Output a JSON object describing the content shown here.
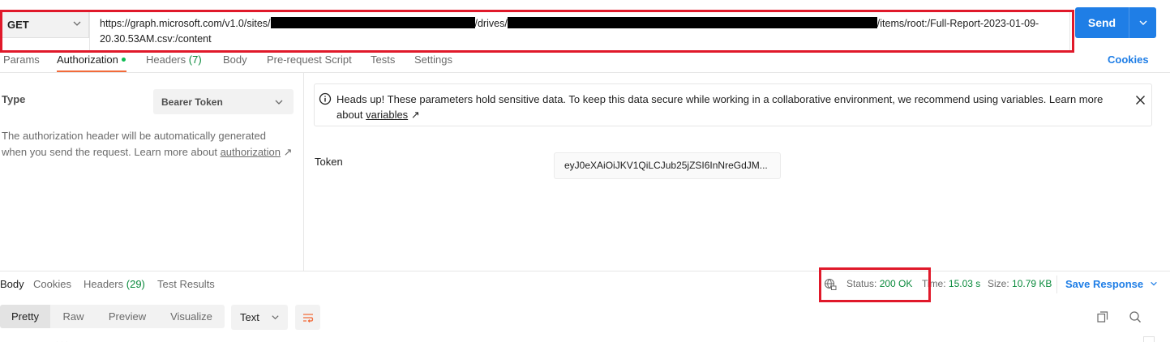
{
  "request": {
    "method": "GET",
    "url_part1": "https://graph.microsoft.com/v1.0/sites/",
    "url_part2": "/drives/",
    "url_part3": "/items/root:/Full-Report-2023-01-09-",
    "url_part4": "20.30.53AM.csv:/content",
    "send_label": "Send"
  },
  "tabs": [
    {
      "label": "Params"
    },
    {
      "label": "Authorization"
    },
    {
      "label": "Headers",
      "count": "(7)"
    },
    {
      "label": "Body"
    },
    {
      "label": "Pre-request Script"
    },
    {
      "label": "Tests"
    },
    {
      "label": "Settings"
    }
  ],
  "cookies_label": "Cookies",
  "auth": {
    "type_label": "Type",
    "type_value": "Bearer Token",
    "description": "The authorization header will be automatically generated when you send the request. Learn more about ",
    "description_link": "authorization",
    "alert_text": "Heads up! These parameters hold sensitive data. To keep this data secure while working in a collaborative environment, we recommend using variables. Learn more about ",
    "alert_link": "variables",
    "token_label": "Token",
    "token_value": "eyJ0eXAiOiJKV1QiLCJub25jZSI6InNreGdJM..."
  },
  "response": {
    "tabs": [
      {
        "label": "Body"
      },
      {
        "label": "Cookies"
      },
      {
        "label": "Headers",
        "count": "(29)"
      },
      {
        "label": "Test Results"
      }
    ],
    "status_label": "Status:",
    "status_value": "200 OK",
    "time_label": "Time:",
    "time_value": "15.03 s",
    "size_label": "Size:",
    "size_value": "10.79 KB",
    "save_label": "Save Response",
    "view_modes": [
      "Pretty",
      "Raw",
      "Preview",
      "Visualize"
    ],
    "format_value": "Text"
  },
  "colors": {
    "accent": "#1f7ee6",
    "highlight": "#e0192a",
    "success": "#0a8a3c",
    "active_tab": "#f26b3a"
  }
}
